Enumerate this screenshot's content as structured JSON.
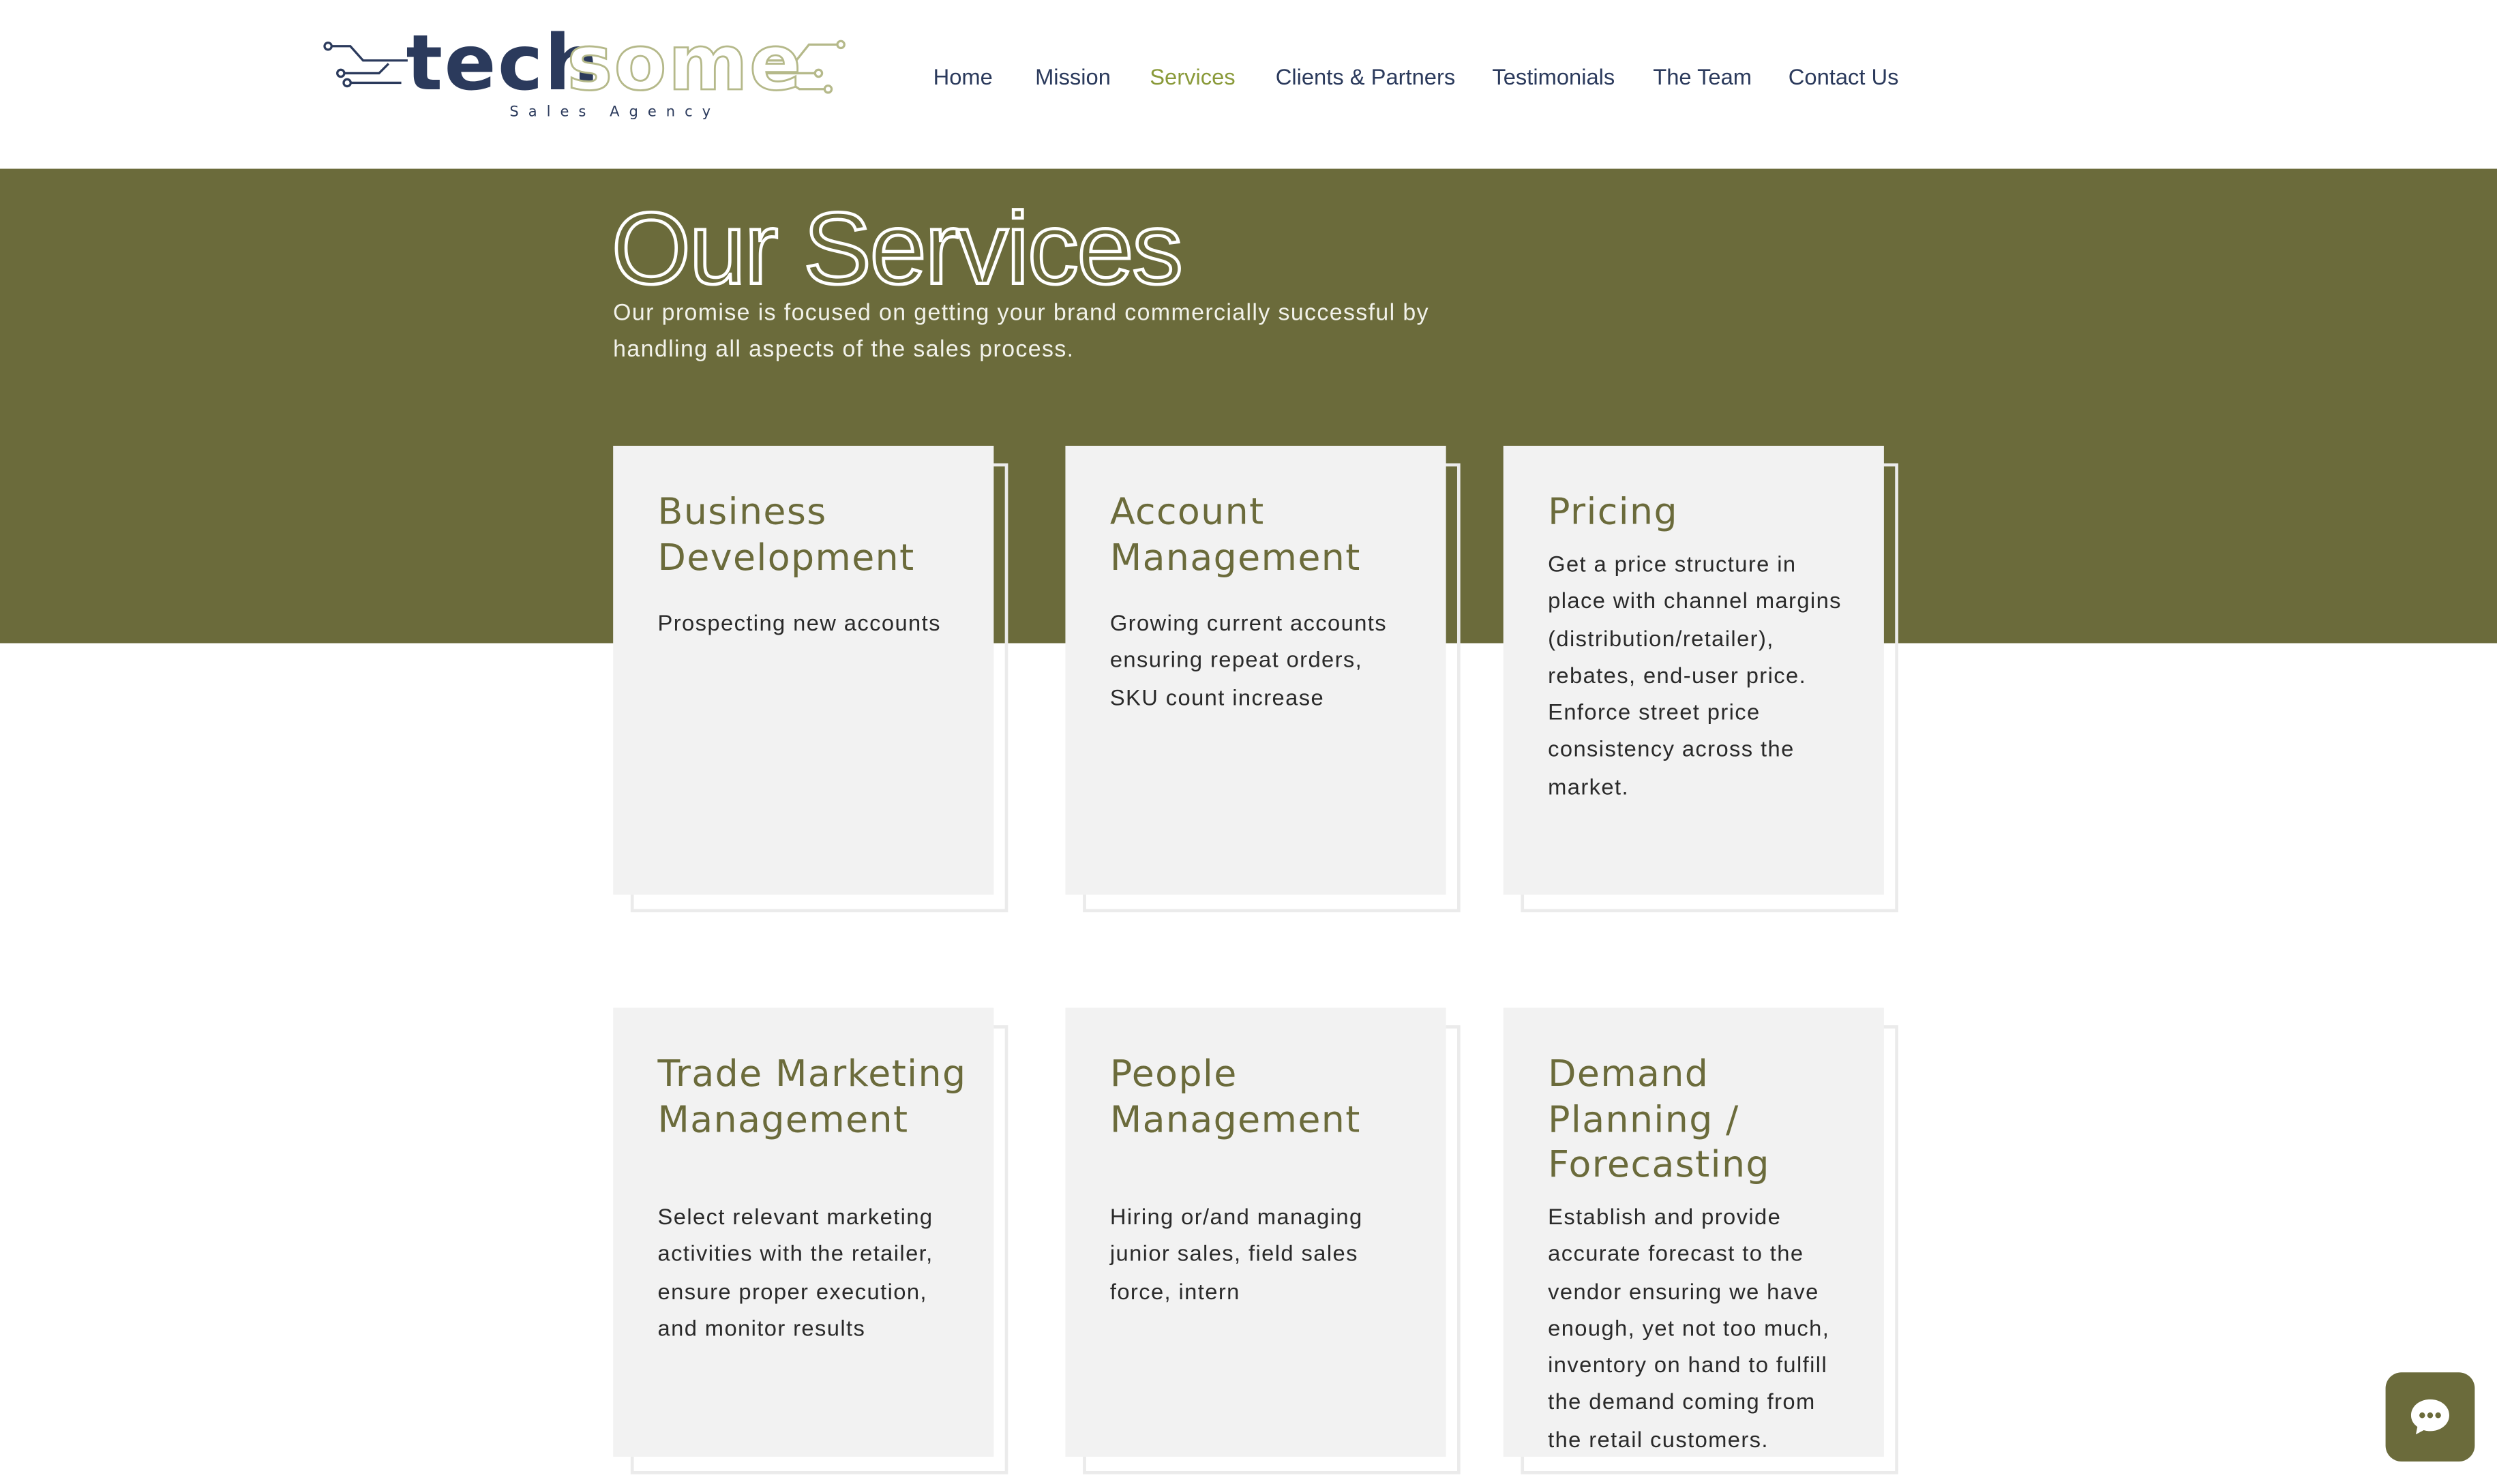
{
  "logo": {
    "word_dark": "tech",
    "word_light": "some",
    "tagline": "Sales  Agency"
  },
  "nav": {
    "items": [
      {
        "label": "Home",
        "active": false
      },
      {
        "label": "Mission",
        "active": false
      },
      {
        "label": "Services",
        "active": true
      },
      {
        "label": "Clients & Partners",
        "active": false
      },
      {
        "label": "Testimonials",
        "active": false
      },
      {
        "label": "The Team",
        "active": false
      },
      {
        "label": "Contact Us",
        "active": false
      }
    ]
  },
  "hero": {
    "title": "Our Services",
    "subtitle": "Our promise is focused on getting your brand commercially successful by handling all aspects of the sales process."
  },
  "services": [
    {
      "title": "Business Development",
      "text": "Prospecting new accounts"
    },
    {
      "title": "Account Management",
      "text": "Growing current accounts ensuring repeat orders, SKU count increase"
    },
    {
      "title": "Pricing",
      "text": "Get a price structure in place with channel margins (distribution/retailer), rebates, end-user price. Enforce street price consistency across the market."
    },
    {
      "title": "Trade Marketing Management",
      "text": "Select relevant marketing activities with the retailer, ensure proper execution, and monitor results"
    },
    {
      "title": "People Management",
      "text": "Hiring or/and managing junior sales, field sales force, intern"
    },
    {
      "title": "Demand Planning / Forecasting",
      "text": "Establish and provide accurate forecast to the vendor ensuring we have enough, yet not too much, inventory on hand to fulfill the demand coming from the retail customers."
    }
  ],
  "chat": {
    "icon": "chat-bubble-icon"
  },
  "colors": {
    "brand_olive": "#6b6b3b",
    "nav_active": "#8a9a3a",
    "nav_text": "#2b3a5c",
    "card_bg": "#f2f2f2"
  }
}
